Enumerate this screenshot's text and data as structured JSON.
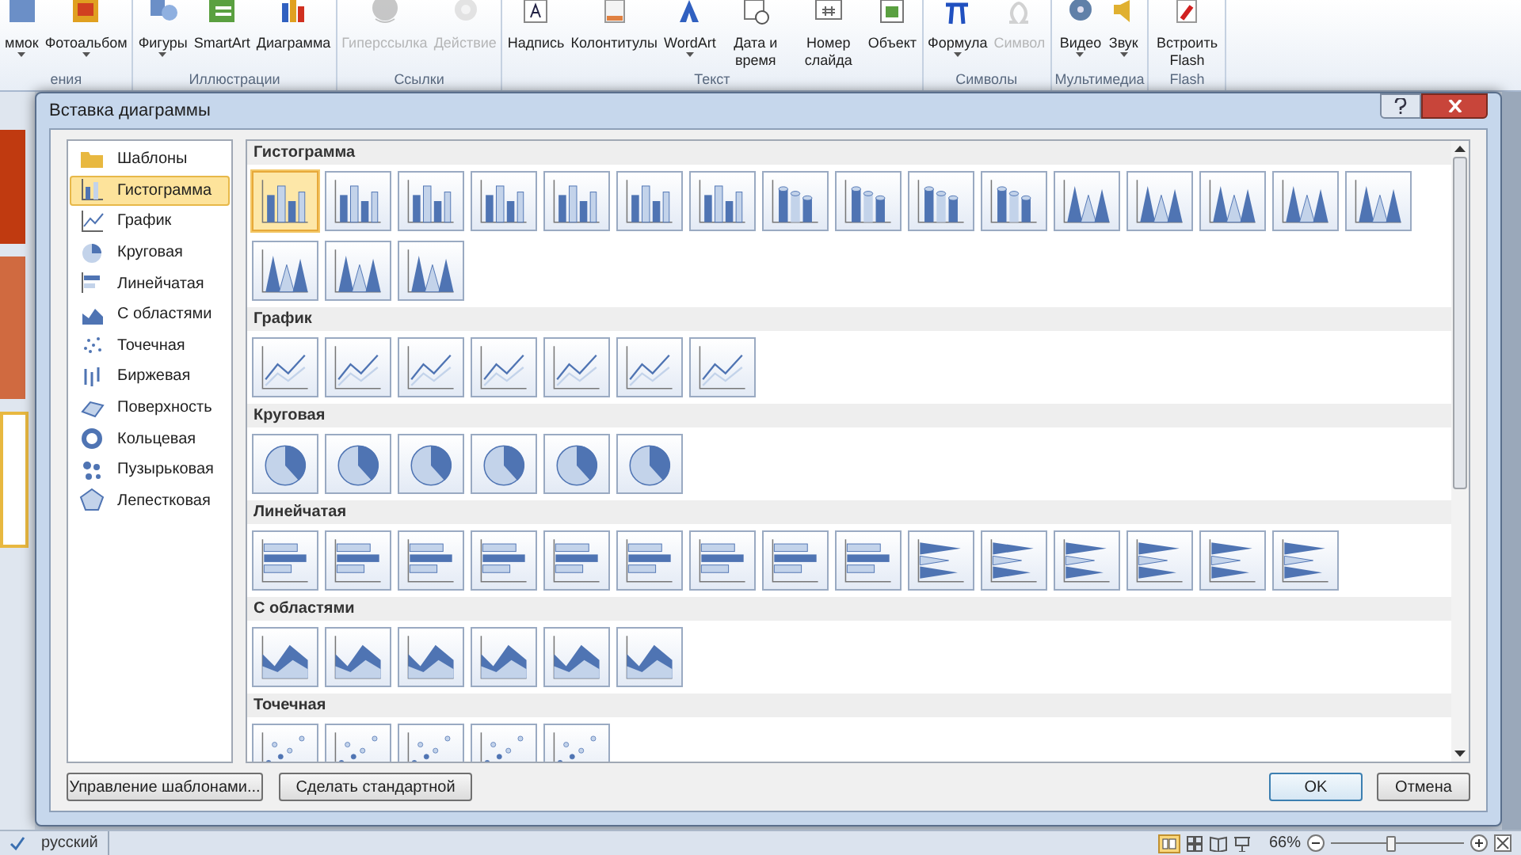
{
  "ribbon": {
    "groups": [
      {
        "label": "ения",
        "buttons": [
          {
            "label": "ммок",
            "kind": "picture",
            "dropdown": true,
            "disabled": false
          },
          {
            "label": "Фотоальбом",
            "kind": "album",
            "dropdown": true,
            "disabled": false
          }
        ]
      },
      {
        "label": "Иллюстрации",
        "buttons": [
          {
            "label": "Фигуры",
            "kind": "shapes",
            "dropdown": true,
            "disabled": false
          },
          {
            "label": "SmartArt",
            "kind": "smartart",
            "dropdown": false,
            "disabled": false
          },
          {
            "label": "Диаграмма",
            "kind": "chart",
            "dropdown": false,
            "disabled": false
          }
        ]
      },
      {
        "label": "Ссылки",
        "buttons": [
          {
            "label": "Гиперссылка",
            "kind": "globe",
            "dropdown": false,
            "disabled": true
          },
          {
            "label": "Действие",
            "kind": "star",
            "dropdown": false,
            "disabled": true
          }
        ]
      },
      {
        "label": "Текст",
        "buttons": [
          {
            "label": "Надпись",
            "kind": "textbox",
            "dropdown": false,
            "disabled": false
          },
          {
            "label": "Колонтитулы",
            "kind": "page",
            "dropdown": false,
            "disabled": false
          },
          {
            "label": "WordArt",
            "kind": "wordart",
            "dropdown": true,
            "disabled": false
          },
          {
            "label": "Дата и время",
            "kind": "calendar",
            "dropdown": false,
            "disabled": false
          },
          {
            "label": "Номер слайда",
            "kind": "number",
            "dropdown": false,
            "disabled": false
          },
          {
            "label": "Объект",
            "kind": "object",
            "dropdown": false,
            "disabled": false
          }
        ]
      },
      {
        "label": "Символы",
        "buttons": [
          {
            "label": "Формула",
            "kind": "pi",
            "dropdown": true,
            "disabled": false
          },
          {
            "label": "Символ",
            "kind": "omega",
            "dropdown": false,
            "disabled": true
          }
        ]
      },
      {
        "label": "Мультимедиа",
        "buttons": [
          {
            "label": "Видео",
            "kind": "film",
            "dropdown": true,
            "disabled": false
          },
          {
            "label": "Звук",
            "kind": "speaker",
            "dropdown": true,
            "disabled": false
          }
        ]
      },
      {
        "label": "Flash",
        "buttons": [
          {
            "label": "Встроить Flash",
            "kind": "flash",
            "dropdown": false,
            "disabled": false
          }
        ]
      }
    ]
  },
  "dialog": {
    "title": "Вставка диаграммы",
    "categories": [
      {
        "label": "Шаблоны",
        "kind": "folder",
        "selected": false
      },
      {
        "label": "Гистограмма",
        "kind": "column",
        "selected": true
      },
      {
        "label": "График",
        "kind": "line",
        "selected": false
      },
      {
        "label": "Круговая",
        "kind": "pie",
        "selected": false
      },
      {
        "label": "Линейчатая",
        "kind": "bar",
        "selected": false
      },
      {
        "label": "С областями",
        "kind": "area",
        "selected": false
      },
      {
        "label": "Точечная",
        "kind": "scatter",
        "selected": false
      },
      {
        "label": "Биржевая",
        "kind": "stock",
        "selected": false
      },
      {
        "label": "Поверхность",
        "kind": "surface",
        "selected": false
      },
      {
        "label": "Кольцевая",
        "kind": "doughnut",
        "selected": false
      },
      {
        "label": "Пузырьковая",
        "kind": "bubble",
        "selected": false
      },
      {
        "label": "Лепестковая",
        "kind": "radar",
        "selected": false
      }
    ],
    "sections": [
      {
        "title": "Гистограмма",
        "items": [
          {
            "kind": "column",
            "selected": true
          },
          {
            "kind": "column",
            "selected": false
          },
          {
            "kind": "column",
            "selected": false
          },
          {
            "kind": "column",
            "selected": false
          },
          {
            "kind": "column",
            "selected": false
          },
          {
            "kind": "column",
            "selected": false
          },
          {
            "kind": "column",
            "selected": false
          },
          {
            "kind": "cylinder",
            "selected": false
          },
          {
            "kind": "cylinder",
            "selected": false
          },
          {
            "kind": "cylinder",
            "selected": false
          },
          {
            "kind": "cylinder",
            "selected": false
          },
          {
            "kind": "cone",
            "selected": false
          },
          {
            "kind": "cone",
            "selected": false
          },
          {
            "kind": "cone",
            "selected": false
          },
          {
            "kind": "cone",
            "selected": false
          },
          {
            "kind": "cone",
            "selected": false
          },
          {
            "kind": "cone",
            "selected": false
          },
          {
            "kind": "cone",
            "selected": false
          },
          {
            "kind": "cone",
            "selected": false
          }
        ]
      },
      {
        "title": "График",
        "items": [
          {
            "kind": "line",
            "selected": false
          },
          {
            "kind": "line",
            "selected": false
          },
          {
            "kind": "line",
            "selected": false
          },
          {
            "kind": "line",
            "selected": false
          },
          {
            "kind": "line",
            "selected": false
          },
          {
            "kind": "line",
            "selected": false
          },
          {
            "kind": "line",
            "selected": false
          }
        ]
      },
      {
        "title": "Круговая",
        "items": [
          {
            "kind": "pie",
            "selected": false
          },
          {
            "kind": "pie",
            "selected": false
          },
          {
            "kind": "pie",
            "selected": false
          },
          {
            "kind": "pie",
            "selected": false
          },
          {
            "kind": "pie",
            "selected": false
          },
          {
            "kind": "pie",
            "selected": false
          }
        ]
      },
      {
        "title": "Линейчатая",
        "items": [
          {
            "kind": "bar",
            "selected": false
          },
          {
            "kind": "bar",
            "selected": false
          },
          {
            "kind": "bar",
            "selected": false
          },
          {
            "kind": "bar",
            "selected": false
          },
          {
            "kind": "bar",
            "selected": false
          },
          {
            "kind": "bar",
            "selected": false
          },
          {
            "kind": "bar",
            "selected": false
          },
          {
            "kind": "bar",
            "selected": false
          },
          {
            "kind": "bar",
            "selected": false
          },
          {
            "kind": "barcone",
            "selected": false
          },
          {
            "kind": "barcone",
            "selected": false
          },
          {
            "kind": "barcone",
            "selected": false
          },
          {
            "kind": "barcone",
            "selected": false
          },
          {
            "kind": "barcone",
            "selected": false
          },
          {
            "kind": "barcone",
            "selected": false
          }
        ]
      },
      {
        "title": "С областями",
        "items": [
          {
            "kind": "area",
            "selected": false
          },
          {
            "kind": "area",
            "selected": false
          },
          {
            "kind": "area",
            "selected": false
          },
          {
            "kind": "area",
            "selected": false
          },
          {
            "kind": "area",
            "selected": false
          },
          {
            "kind": "area",
            "selected": false
          }
        ]
      },
      {
        "title": "Точечная",
        "items": [
          {
            "kind": "scatter",
            "selected": false
          },
          {
            "kind": "scatter",
            "selected": false
          },
          {
            "kind": "scatter",
            "selected": false
          },
          {
            "kind": "scatter",
            "selected": false
          },
          {
            "kind": "scatter",
            "selected": false
          }
        ]
      }
    ],
    "left_buttons": [
      "Управление шаблонами...",
      "Сделать стандартной"
    ],
    "ok": "OK",
    "cancel": "Отмена"
  },
  "status_bar": {
    "language": "русский",
    "zoom": "66%",
    "zoom_slider": {
      "level": 0.45
    }
  }
}
